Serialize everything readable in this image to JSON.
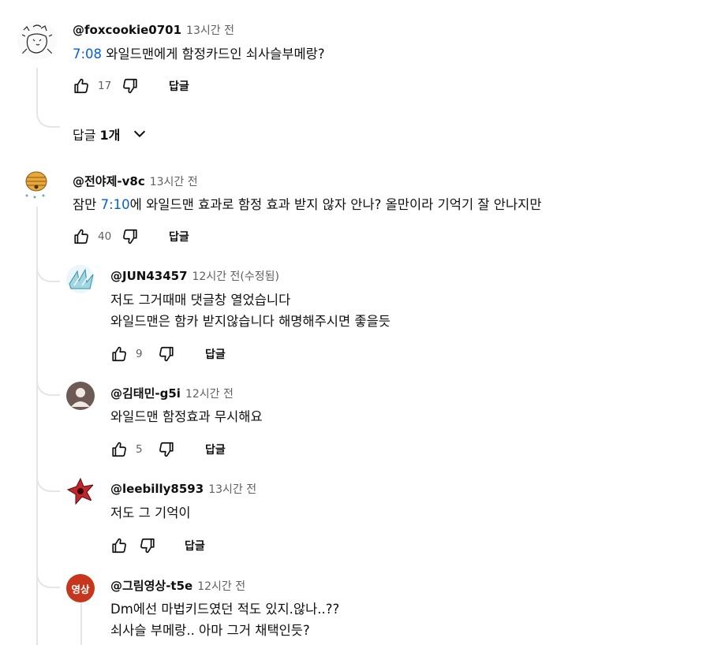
{
  "comments": [
    {
      "author": "@foxcookie0701",
      "time": "13시간 전",
      "timestamp": "7:08",
      "text_rest": " 와일드맨에게 함정카드인 쇠사슬부메랑?",
      "likes": "17",
      "reply_label": "답글"
    },
    {
      "author": "@전야제-v8c",
      "time": "13시간 전",
      "text_pre": "잠만 ",
      "timestamp": "7:10",
      "text_rest": "에 와일드맨 효과로 함정 효과 받지 않자 안나? 올만이라 기억기 잘 안나지만",
      "likes": "40",
      "reply_label": "답글"
    }
  ],
  "replies_toggle": {
    "label": "답글 ",
    "count": "1개"
  },
  "replies": [
    {
      "author": "@JUN43457",
      "time": "12시간 전(수정됨)",
      "line1": "저도 그거때매 댓글창 열었습니다",
      "line2": "와일드맨은 함카 받지않습니다 해명해주시면 좋을듯",
      "likes": "9",
      "reply_label": "답글"
    },
    {
      "author": "@김태민-g5i",
      "time": "12시간 전",
      "line1": "와일드맨 함정효과 무시해요",
      "likes": "5",
      "reply_label": "답글"
    },
    {
      "author": "@leebilly8593",
      "time": "13시간 전",
      "line1": "저도 그 기억이",
      "likes": "",
      "reply_label": "답글"
    },
    {
      "author": "@그림영상-t5e",
      "time": "12시간 전",
      "avatar_text": "영상",
      "line1": "Dm에선 마법키드였던 적도 있지.않나..??",
      "line2": "쇠사슬 부메랑.. 아마 그거 채택인듯?"
    }
  ],
  "colors": {
    "link": "#065fd4",
    "muted": "#606060",
    "avatar_red": "#c6361d",
    "line": "#e5e5e5"
  }
}
